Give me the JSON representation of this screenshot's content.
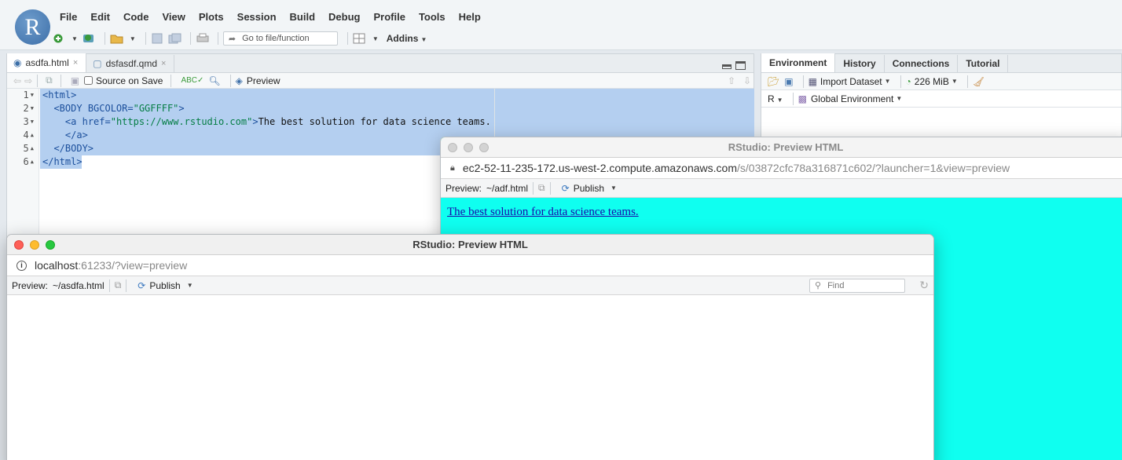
{
  "menu": [
    "File",
    "Edit",
    "Code",
    "View",
    "Plots",
    "Session",
    "Build",
    "Debug",
    "Profile",
    "Tools",
    "Help"
  ],
  "toolbar": {
    "goto_placeholder": "Go to file/function",
    "addins_label": "Addins"
  },
  "logo_letter": "R",
  "editor": {
    "tabs": [
      {
        "label": "asdfa.html"
      },
      {
        "label": "dsfasdf.qmd"
      }
    ],
    "source_on_save": "Source on Save",
    "preview_label": "Preview",
    "line_numbers": [
      "1",
      "2",
      "3",
      "4",
      "5",
      "6"
    ],
    "code": {
      "l1_tag": "<html>",
      "l2_open": "<BODY ",
      "l2_attr": "BGCOLOR=",
      "l2_val": "\"GGFFFF\"",
      "l2_close": ">",
      "l3_open": "<a ",
      "l3_attr": "href=",
      "l3_val": "\"https://www.rstudio.com\"",
      "l3_close": ">",
      "l3_text": "The best solution for data science teams.",
      "l4_tag": "</a>",
      "l5_tag": "</BODY>",
      "l6_tag": "</html>"
    }
  },
  "environment": {
    "tabs": [
      "Environment",
      "History",
      "Connections",
      "Tutorial"
    ],
    "import_label": "Import Dataset",
    "memory": "226 MiB",
    "lang": "R",
    "scope": "Global Environment"
  },
  "preview_back": {
    "title": "RStudio: Preview HTML",
    "url_host": "ec2-52-11-235-172.us-west-2.compute.amazonaws.com",
    "url_path": "/s/03872cfc78a316871c602/?launcher=1&view=preview",
    "preview_label": "Preview:",
    "preview_file": "~/adf.html",
    "publish_label": "Publish",
    "link_text": "The best solution for data science teams."
  },
  "preview_front": {
    "title": "RStudio: Preview HTML",
    "url_host": "localhost",
    "url_path": ":61233/?view=preview",
    "preview_label": "Preview:",
    "preview_file": "~/asdfa.html",
    "publish_label": "Publish",
    "find_placeholder": "Find"
  },
  "colors": {
    "preview_bg": "#0ffff0",
    "selection": "#b4cff0",
    "accent": "#3d6fa8"
  }
}
